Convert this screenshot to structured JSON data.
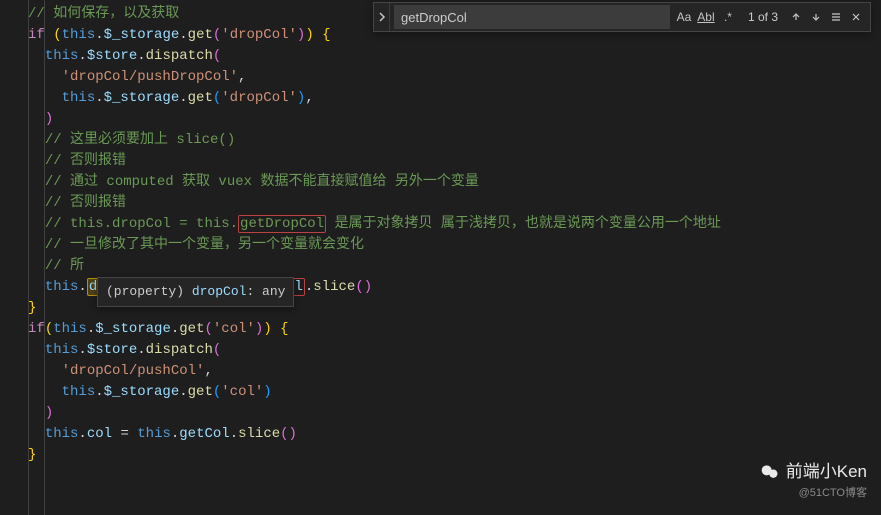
{
  "findWidget": {
    "query": "getDropCol",
    "count": "1 of 3",
    "caseSensitive": "Aa",
    "wholeWord": "Abl",
    "regex": ".*"
  },
  "tooltip": {
    "prefix": "(property) ",
    "name": "dropCol",
    "suffix": ": any"
  },
  "watermark": {
    "main": "前端小Ken",
    "sub": "@51CTO博客"
  },
  "code": {
    "c1": "// 如何保存，以及获取",
    "if1": "if",
    "storage": "$_storage",
    "get": "get",
    "dropCol": "'dropCol'",
    "store": "$store",
    "dispatch": "dispatch",
    "pushDropCol": "'dropCol/pushDropCol'",
    "c2": "// 这里必须要加上 slice()",
    "c3": "// 否则报错",
    "c4_a": "// 通过 computed 获取 vuex 数据不能直接赋值给 另外一个变量",
    "c5": "// 否则报错",
    "c6_a": "// this.dropCol = this.",
    "c6_hl": "getDropCol",
    "c6_b": " 是属于对象拷贝 属于浅拷贝，也就是说两个变量公用一个地址",
    "c7": "// 一旦修改了其中一个变量，另一个变量就会变化",
    "c8": "// 所",
    "dropColProp": "dropCol",
    "getDropCol": "getDropCol",
    "slice": "slice",
    "col": "'col'",
    "pushCol": "'dropCol/pushCol'",
    "colProp": "col",
    "getCol": "getCol",
    "thisKw": "this"
  }
}
